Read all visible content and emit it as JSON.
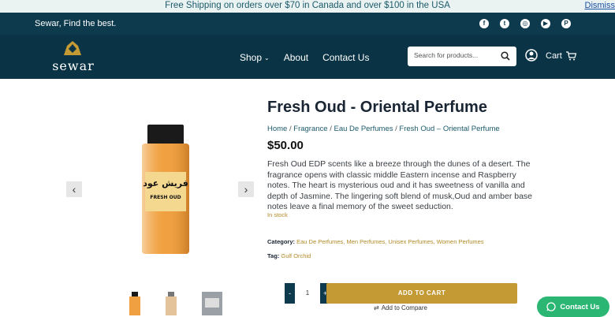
{
  "promo": {
    "text": "Free Shipping on orders over $70 in Canada and over $100 in the USA",
    "dismiss": "Dismiss"
  },
  "topbar": {
    "tagline": "Sewar, Find the best.",
    "social": [
      "f",
      "t",
      "◎",
      "▶",
      "P"
    ]
  },
  "header": {
    "logo_text": "sewar",
    "nav": [
      "Shop",
      "About",
      "Contact Us"
    ],
    "search_placeholder": "Search for products...",
    "cart_label": "Cart"
  },
  "product": {
    "title": "Fresh Oud - Oriental Perfume",
    "breadcrumbs": [
      "Home",
      "Fragrance",
      "Eau De Perfumes",
      "Fresh Oud – Oriental Perfume"
    ],
    "price": "$50.00",
    "description": "Fresh Oud EDP scents like a breeze through the dunes of a desert. The fragrance opens with classic middle Eastern incense and Raspberry notes. The heart is mysterious oud and it has sweetness of vanilla and depth of Jasmine. The lingering soft blend of musk,Oud and amber base notes leave a final memory of the sweet seduction.",
    "stock": "In stock",
    "category_label": "Category:",
    "categories": "Eau De Perfumes, Men Perfumes, Unisex Perfumes, Women Perfumes",
    "tag_label": "Tag:",
    "tag": "Gulf Orchid",
    "label_arabic": "فريش عود",
    "label_english": "FRESH OUD",
    "quantity": "1",
    "add_to_cart": "ADD TO CART",
    "compare": "Add to Compare"
  },
  "contact_button": "Contact Us"
}
